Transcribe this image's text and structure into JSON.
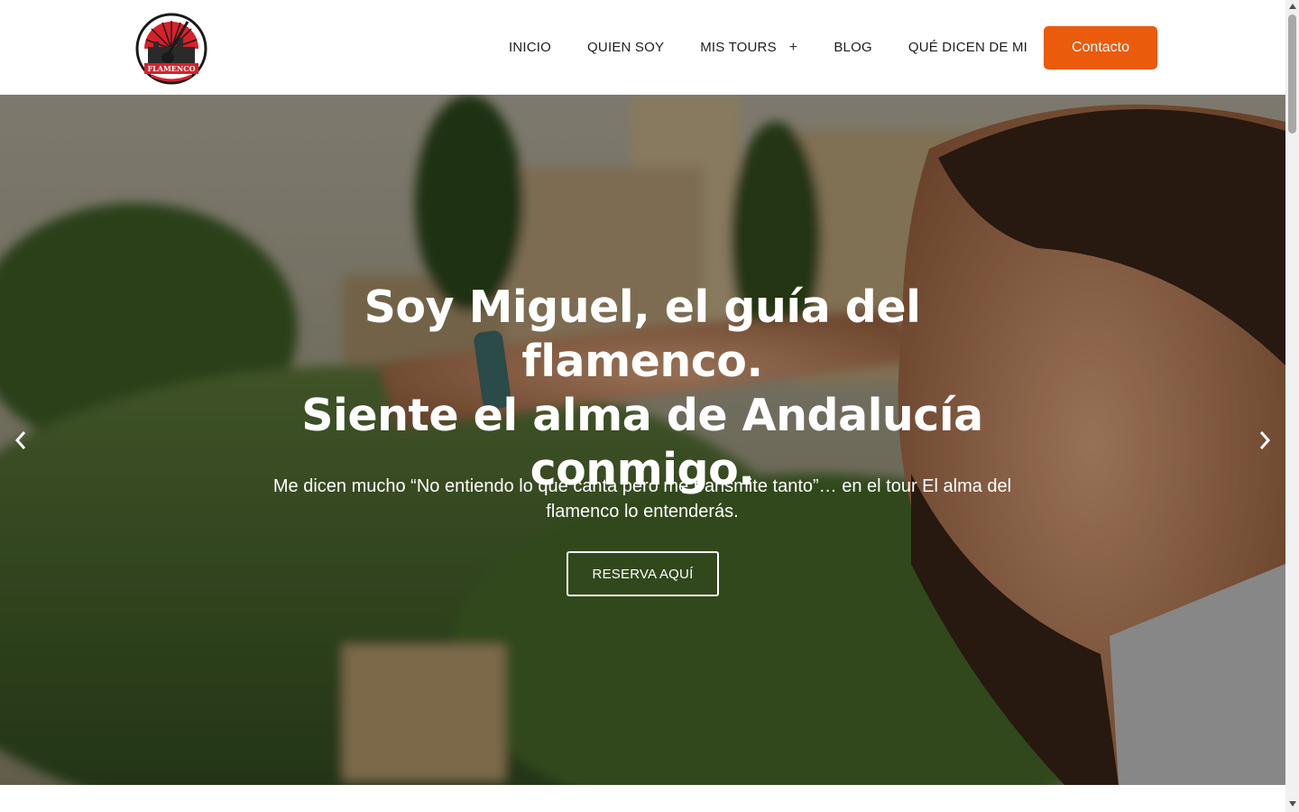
{
  "header": {
    "logo_text": "FLAMENCO",
    "nav": [
      {
        "label": "INICIO"
      },
      {
        "label": "QUIEN SOY"
      },
      {
        "label": "MIS TOURS",
        "expand_icon": "+"
      },
      {
        "label": "BLOG"
      },
      {
        "label": "QUÉ DICEN DE MI"
      }
    ],
    "contact_label": "Contacto"
  },
  "hero": {
    "title_line1": "Soy Miguel, el guía del flamenco.",
    "title_line2": "Siente el alma de Andalucía",
    "title_line3": "conmigo.",
    "subtitle": "Me dicen mucho “No entiendo lo que canta pero me transmite tanto”… en el tour El alma del flamenco lo entenderás.",
    "cta_label": "RESERVA AQUÍ",
    "prev_icon": "chevron-left-icon",
    "next_icon": "chevron-right-icon"
  },
  "colors": {
    "accent": "#ea5b0c",
    "nav_text": "#1d1d1d",
    "hero_text": "#ffffff"
  }
}
